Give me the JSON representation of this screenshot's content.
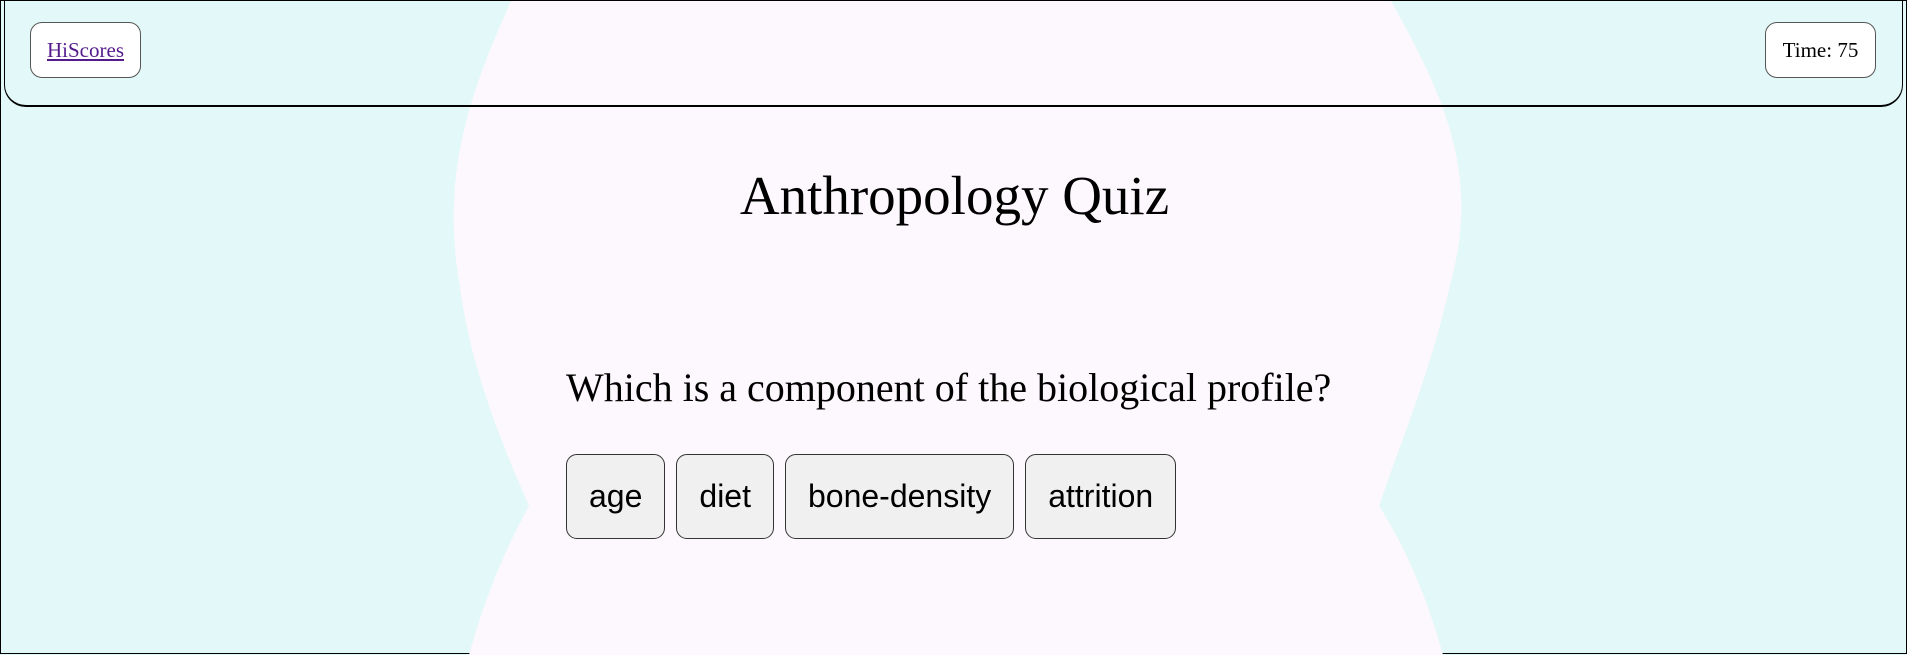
{
  "colors": {
    "page_background": "#e3f8f8",
    "center_blob": "#fdf8fd",
    "button_background": "#f0f0f0",
    "link_color": "#551a8b"
  },
  "header": {
    "hiscores_link": "HiScores",
    "timer": "Time: 75"
  },
  "main": {
    "title": "Anthropology Quiz",
    "question": "Which is a component of the biological profile?",
    "answers": [
      "age",
      "diet",
      "bone-density",
      "attrition"
    ]
  }
}
